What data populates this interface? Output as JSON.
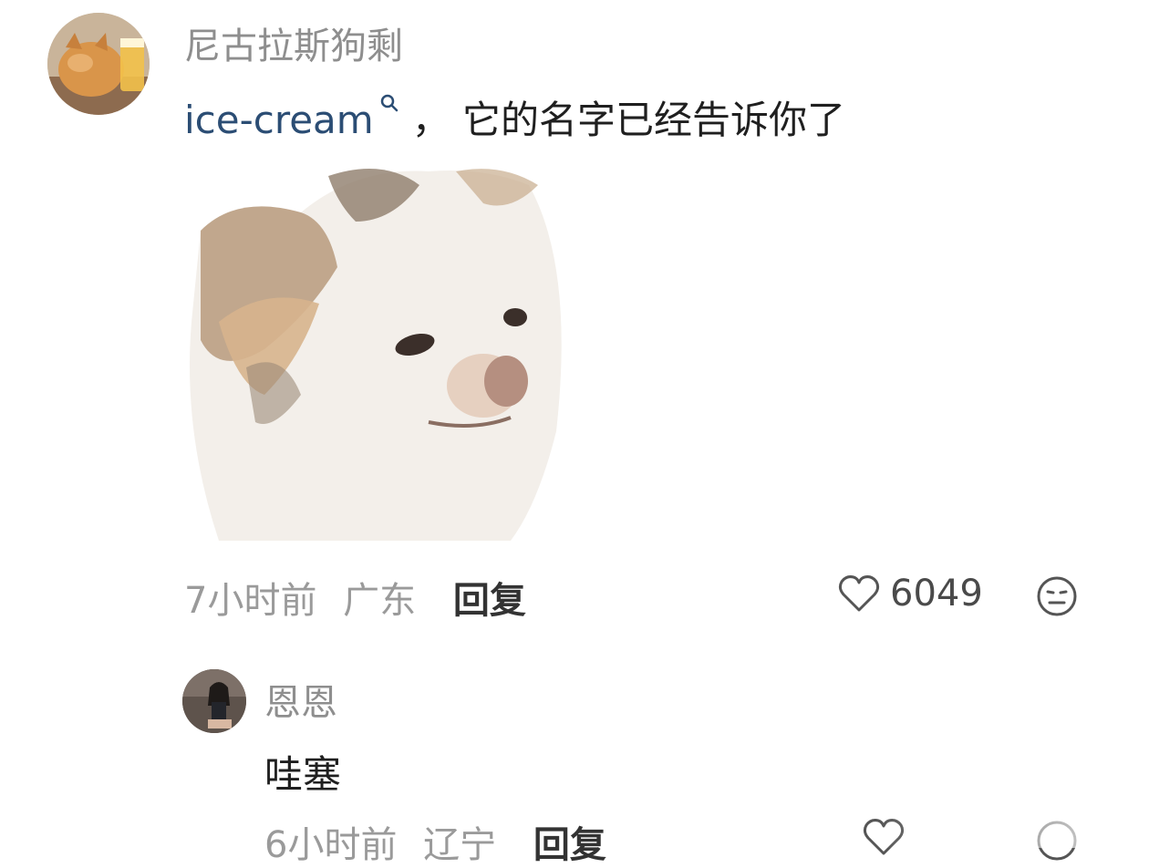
{
  "comments": [
    {
      "user": "尼古拉斯狗剩",
      "text_link": "ice-cream",
      "text_rest": "， 它的名字已经告诉你了",
      "time": "7小时前",
      "location": "广东",
      "reply_label": "回复",
      "likes": "6049",
      "icons": [
        "heart-icon",
        "emoji-icon",
        "search-icon"
      ]
    },
    {
      "user": "恩恩",
      "text": "哇塞",
      "time": "6小时前",
      "location": "辽宁",
      "reply_label": "回复"
    }
  ]
}
